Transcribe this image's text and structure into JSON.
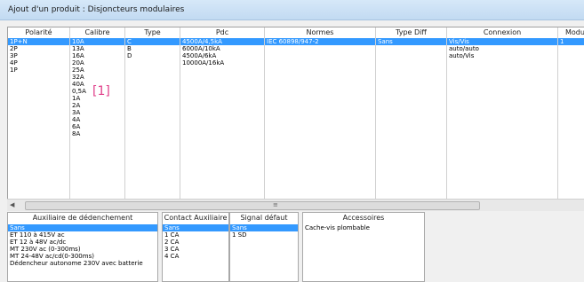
{
  "window": {
    "title": "Ajout d'un produit : Disjoncteurs modulaires"
  },
  "columns": [
    {
      "header": "Polarité",
      "items": [
        "1P+N",
        "2P",
        "3P",
        "4P",
        "1P"
      ],
      "selected": 0
    },
    {
      "header": "Calibre",
      "items": [
        "10A",
        "13A",
        "16A",
        "20A",
        "25A",
        "32A",
        "40A",
        "0,5A",
        "1A",
        "2A",
        "3A",
        "4A",
        "6A",
        "8A"
      ],
      "selected": 0
    },
    {
      "header": "Type",
      "items": [
        "C",
        "B",
        "D"
      ],
      "selected": 0
    },
    {
      "header": "Pdc",
      "items": [
        "4500A/4,5kA",
        "6000A/10kA",
        "4500A/6kA",
        "10000A/16kA"
      ],
      "selected": 0
    },
    {
      "header": "Normes",
      "items": [
        "IEC 60898/947-2"
      ],
      "selected": 0
    },
    {
      "header": "Type Diff",
      "items": [
        "Sans"
      ],
      "selected": 0
    },
    {
      "header": "Connexion",
      "items": [
        "Vis/Vis",
        "auto/auto",
        "auto/Vis"
      ],
      "selected": 0
    },
    {
      "header": "Modul",
      "items": [
        "1"
      ],
      "selected": 0
    }
  ],
  "annotation": "[1]",
  "bottom": {
    "aux_decl": {
      "header": "Auxiliaire de dédenchement",
      "items": [
        "Sans",
        "ET 110 à  415V ac",
        "ET 12 à 48V  ac/dc",
        "MT 230V ac (0-300ms)",
        "MT 24-48V ac/cd(0-300ms)",
        "Dédencheur autonome 230V avec batterie"
      ],
      "selected": 0
    },
    "contact_aux": {
      "header": "Contact Auxiliaire",
      "items": [
        "Sans",
        "1 CA",
        "2 CA",
        "3 CA",
        "4 CA"
      ],
      "selected": 0
    },
    "signal": {
      "header": "Signal défaut",
      "items": [
        "Sans",
        "1 SD"
      ],
      "selected": 0
    },
    "accessoires": {
      "header": "Accessoires",
      "items": [
        "Cache-vis plombable"
      ],
      "selected": -1
    }
  }
}
